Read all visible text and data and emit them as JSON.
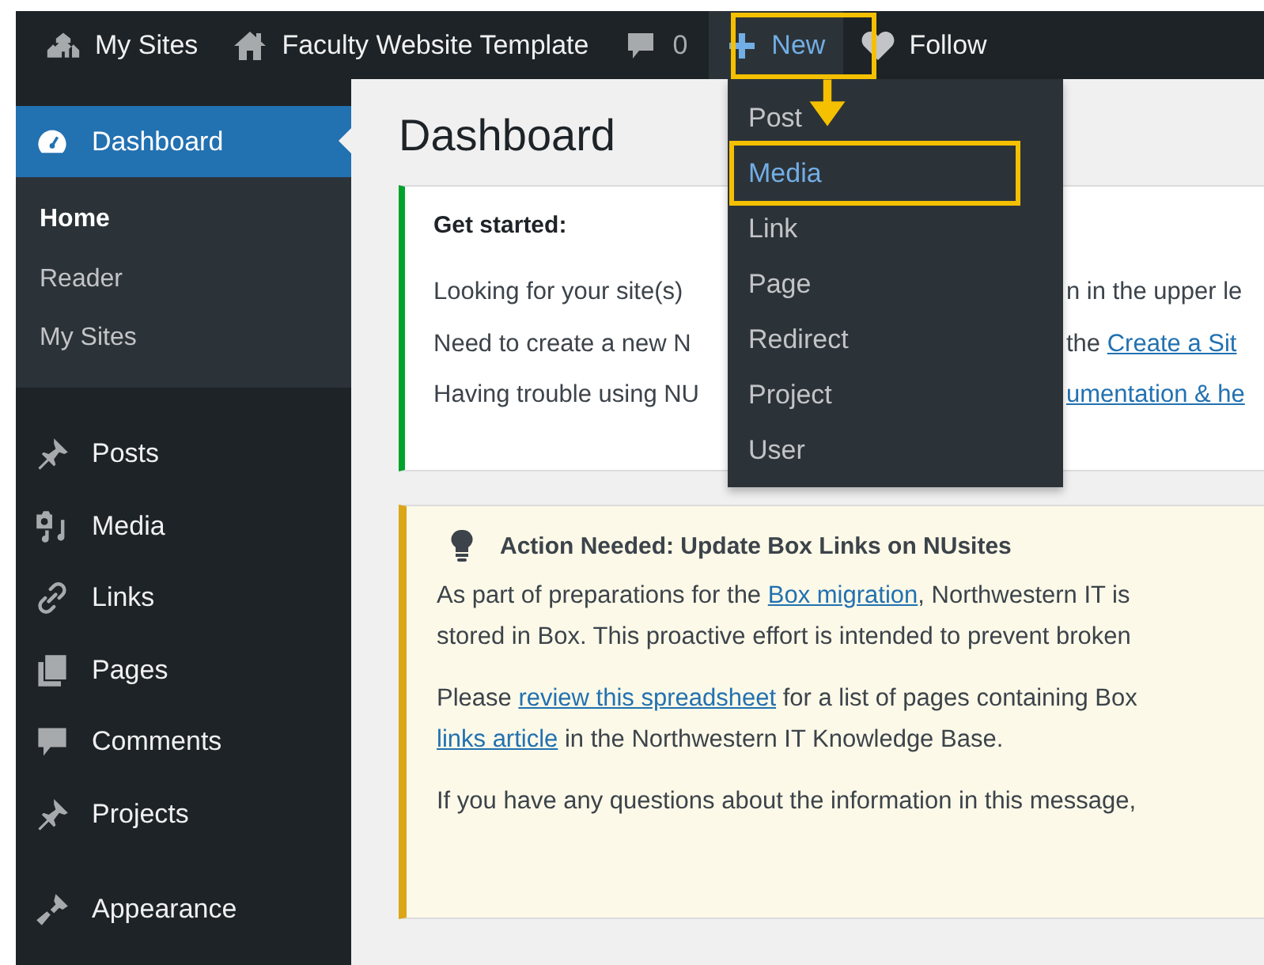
{
  "admin_bar": {
    "items": [
      {
        "label": "My Sites"
      },
      {
        "label": "Faculty Website Template"
      },
      {
        "label": "0"
      }
    ],
    "new_button": {
      "label": "New",
      "open": true,
      "highlighted": true
    },
    "follow": {
      "label": "Follow"
    }
  },
  "new_menu": {
    "items": [
      {
        "label": "Post",
        "selected": false
      },
      {
        "label": "Media",
        "selected": true
      },
      {
        "label": "Link",
        "selected": false
      },
      {
        "label": "Page",
        "selected": false
      },
      {
        "label": "Redirect",
        "selected": false
      },
      {
        "label": "Project",
        "selected": false
      },
      {
        "label": "User",
        "selected": false
      }
    ]
  },
  "sidebar": {
    "items": [
      {
        "label": "Dashboard",
        "selected": true,
        "children": [
          {
            "label": "Home",
            "selected": true
          },
          {
            "label": "Reader",
            "selected": false
          },
          {
            "label": "My Sites",
            "selected": false
          }
        ]
      },
      {
        "label": "Posts",
        "selected": false
      },
      {
        "label": "Media",
        "selected": false
      },
      {
        "label": "Links",
        "selected": false
      },
      {
        "label": "Pages",
        "selected": false
      },
      {
        "label": "Comments",
        "selected": false
      },
      {
        "label": "Projects",
        "selected": false
      },
      {
        "label": "Appearance",
        "selected": false
      }
    ]
  },
  "page_title": "Dashboard",
  "get_started": {
    "title": "Get started:",
    "lines": [
      {
        "left": "Looking for your site(s)",
        "right": "n in the upper le"
      },
      {
        "left": "Need to create a new N",
        "right": "the ",
        "link": "Create a Sit"
      },
      {
        "left": "Having trouble using NU",
        "link": "umentation & he"
      }
    ]
  },
  "notice": {
    "title": "Action Needed: Update Box Links on NUsites",
    "paragraphs": [
      [
        {
          "text": "As part of preparations for the "
        },
        {
          "text": "Box migration",
          "link": true
        },
        {
          "text": ", Northwestern IT is"
        }
      ],
      [
        {
          "text": "stored in Box. This proactive effort is intended to prevent broken"
        }
      ],
      [
        {
          "text": "Please "
        },
        {
          "text": "review this spreadsheet",
          "link": true
        },
        {
          "text": " for a list of pages containing Box"
        }
      ],
      [
        {
          "text": "links article",
          "link": true
        },
        {
          "text": " in the Northwestern IT Knowledge Base."
        }
      ],
      [
        {
          "text": "If you have any questions about the information in this message,"
        }
      ]
    ]
  }
}
